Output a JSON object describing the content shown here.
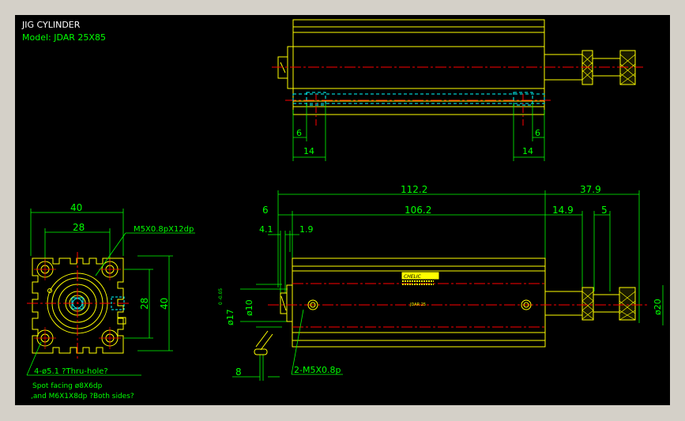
{
  "header": {
    "title": "JIG CYLINDER",
    "model": "Model:  JDAR 25X85"
  },
  "colors": {
    "background": "#000000",
    "frame": "#d4d0c8",
    "outline": "#ffff00",
    "dimension": "#00ff00",
    "centerline": "#ff0000",
    "hidden": "#00ffff",
    "title_text": "#ffffff",
    "model_text": "#00ff00"
  },
  "top_view": {
    "dims": {
      "left_small": "6",
      "right_small": "6",
      "left_width": "14",
      "right_width": "14"
    }
  },
  "front_view": {
    "dims": {
      "overall_body": "112.2",
      "rod_extension": "37.9",
      "offset_left": "6",
      "inner_length": "106.2",
      "rod_nut": "14.9",
      "rod_end": "5",
      "step_a": "4.1",
      "step_b": "1.9",
      "bore_dia": "ø17",
      "bore_tol": "0\n-0.05",
      "rod_dia": "ø10",
      "nut_dia": "ø20",
      "port_depth": "8"
    },
    "labels": {
      "port_callout": "2-M5X0.8p",
      "body_mark": "JDAR 25"
    }
  },
  "end_view": {
    "dims": {
      "width_outer": "40",
      "width_inner": "28",
      "height_inner": "28",
      "height_outer": "40"
    },
    "notes": {
      "thread": "M5X0.8pX12dp",
      "holes": "4-ø5.1 ?Thru-hole?",
      "spot": "Spot facing  ø8X6dp",
      "thread2": ",and M6X1X8dp ?Both sides?"
    }
  }
}
